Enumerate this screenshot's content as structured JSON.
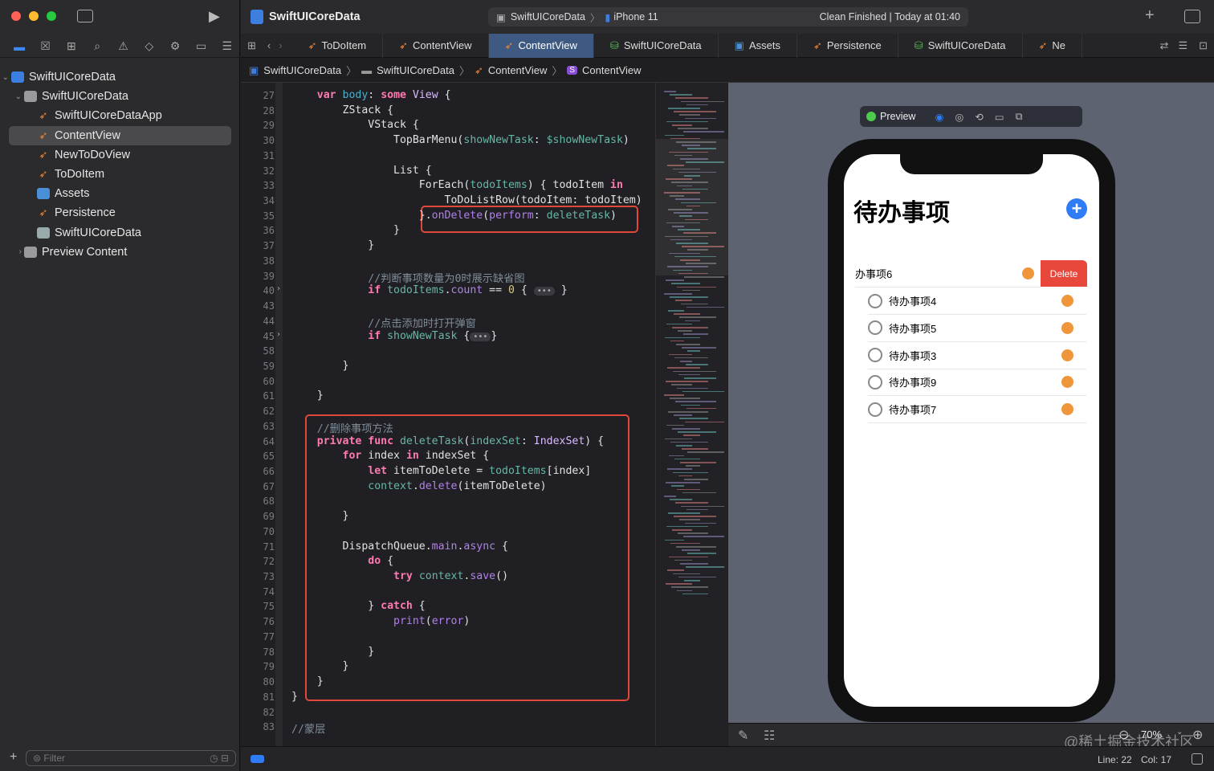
{
  "window": {
    "project": "SwiftUICoreData",
    "scheme": "SwiftUICoreData",
    "device": "iPhone 11",
    "status": "Clean Finished | Today at 01:40"
  },
  "sidebar": {
    "items": [
      {
        "label": "SwiftUICoreData",
        "icon": "project-icon",
        "level": 0,
        "expanded": true
      },
      {
        "label": "SwiftUICoreData",
        "icon": "folder-icon",
        "level": 1,
        "expanded": true
      },
      {
        "label": "SwiftUICoreDataApp",
        "icon": "swift-file-icon",
        "level": 2
      },
      {
        "label": "ContentView",
        "icon": "swift-file-icon",
        "level": 2,
        "selected": true
      },
      {
        "label": "NewToDoView",
        "icon": "swift-file-icon",
        "level": 2
      },
      {
        "label": "ToDoItem",
        "icon": "swift-file-icon",
        "level": 2
      },
      {
        "label": "Assets",
        "icon": "assets-icon",
        "level": 2
      },
      {
        "label": "Persistence",
        "icon": "swift-file-icon",
        "level": 2
      },
      {
        "label": "SwiftUICoreData",
        "icon": "coredata-icon",
        "level": 2
      },
      {
        "label": "Preview Content",
        "icon": "folder-icon",
        "level": 1,
        "expanded": false
      }
    ],
    "filter_placeholder": "Filter"
  },
  "tabs": [
    {
      "label": "ToDoItem"
    },
    {
      "label": "ContentView"
    },
    {
      "label": "ContentView",
      "active": true
    },
    {
      "label": "SwiftUICoreData"
    },
    {
      "label": "Assets"
    },
    {
      "label": "Persistence"
    },
    {
      "label": "SwiftUICoreData"
    },
    {
      "label": "Ne"
    }
  ],
  "breadcrumb": [
    "SwiftUICoreData",
    "SwiftUICoreData",
    "ContentView",
    "ContentView"
  ],
  "code": [
    {
      "n": "27",
      "t": [
        [
          "    ",
          "d"
        ],
        [
          "var",
          "k"
        ],
        [
          " body",
          "b"
        ],
        [
          ": ",
          "d"
        ],
        [
          "some",
          "k"
        ],
        [
          " View",
          "t"
        ],
        [
          " {",
          "d"
        ]
      ]
    },
    {
      "n": "28",
      "t": [
        [
          "        ZStack {",
          "d"
        ]
      ]
    },
    {
      "n": "29",
      "t": [
        [
          "            VStack {",
          "d"
        ]
      ]
    },
    {
      "n": "30",
      "t": [
        [
          "                TopBarMenu(",
          "d"
        ],
        [
          "showNewTask",
          "p"
        ],
        [
          ": ",
          "d"
        ],
        [
          "$showNewTask",
          "p"
        ],
        [
          ")",
          "d"
        ]
      ]
    },
    {
      "n": "31",
      "t": []
    },
    {
      "n": "32",
      "t": [
        [
          "                List {",
          "d"
        ]
      ]
    },
    {
      "n": "33",
      "t": [
        [
          "                    ForEach(",
          "d"
        ],
        [
          "todoItems",
          "p"
        ],
        [
          ") { todoItem ",
          "d"
        ],
        [
          "in",
          "k"
        ]
      ]
    },
    {
      "n": "34",
      "t": [
        [
          "                        ToDoListRow(todoItem: todoItem)",
          "d"
        ]
      ]
    },
    {
      "n": "35",
      "t": [
        [
          "                    }.",
          "d"
        ],
        [
          "onDelete",
          "m"
        ],
        [
          "(",
          "d"
        ],
        [
          "perform",
          "m"
        ],
        [
          ": ",
          "d"
        ],
        [
          "deleteTask",
          "p"
        ],
        [
          ")",
          "d"
        ]
      ]
    },
    {
      "n": "36",
      "t": [
        [
          "                }",
          "d"
        ]
      ]
    },
    {
      "n": "37",
      "t": [
        [
          "            }",
          "d"
        ]
      ]
    },
    {
      "n": "38",
      "t": []
    },
    {
      "n": "39",
      "t": [
        [
          "            //判断事项数量为0时展示缺省图",
          "c"
        ]
      ]
    },
    {
      "n": "40",
      "t": [
        [
          "            ",
          "d"
        ],
        [
          "if",
          "k"
        ],
        [
          " todoItems",
          "p"
        ],
        [
          ".",
          "d"
        ],
        [
          "count",
          "m"
        ],
        [
          " == ",
          "d"
        ],
        [
          "0",
          "n"
        ],
        [
          " { ",
          "d"
        ],
        [
          "•••",
          "fold"
        ],
        [
          " }",
          "d"
        ]
      ]
    },
    {
      "n": "43",
      "t": []
    },
    {
      "n": "44",
      "t": [
        [
          "            //点击添加时打开弹窗",
          "c"
        ]
      ]
    },
    {
      "n": "45",
      "t": [
        [
          "            ",
          "d"
        ],
        [
          "if",
          "k"
        ],
        [
          " showNewTask",
          "p"
        ],
        [
          " {",
          "d"
        ],
        [
          "•••",
          "fold"
        ],
        [
          "}",
          "d"
        ]
      ]
    },
    {
      "n": "58",
      "t": []
    },
    {
      "n": "59",
      "t": [
        [
          "        }",
          "d"
        ]
      ]
    },
    {
      "n": "60",
      "t": []
    },
    {
      "n": "61",
      "t": [
        [
          "    }",
          "d"
        ]
      ]
    },
    {
      "n": "62",
      "t": []
    },
    {
      "n": "63",
      "t": [
        [
          "    //删除事项方法",
          "c"
        ]
      ]
    },
    {
      "n": "64",
      "t": [
        [
          "    ",
          "d"
        ],
        [
          "private func",
          "k"
        ],
        [
          " deleteTask",
          "p"
        ],
        [
          "(",
          "d"
        ],
        [
          "indexSet",
          "p"
        ],
        [
          ": ",
          "d"
        ],
        [
          "IndexSet",
          "t"
        ],
        [
          ") {",
          "d"
        ]
      ]
    },
    {
      "n": "65",
      "t": [
        [
          "        ",
          "d"
        ],
        [
          "for",
          "k"
        ],
        [
          " index ",
          "d"
        ],
        [
          "in",
          "k"
        ],
        [
          " indexSet {",
          "d"
        ]
      ]
    },
    {
      "n": "66",
      "t": [
        [
          "            ",
          "d"
        ],
        [
          "let",
          "k"
        ],
        [
          " itemToDelete = ",
          "d"
        ],
        [
          "todoItems",
          "p"
        ],
        [
          "[index]",
          "d"
        ]
      ]
    },
    {
      "n": "67",
      "t": [
        [
          "            ",
          "d"
        ],
        [
          "context",
          "p"
        ],
        [
          ".",
          "d"
        ],
        [
          "delete",
          "m"
        ],
        [
          "(itemToDelete)",
          "d"
        ]
      ]
    },
    {
      "n": "68",
      "t": []
    },
    {
      "n": "69",
      "t": [
        [
          "        }",
          "d"
        ]
      ]
    },
    {
      "n": "70",
      "t": []
    },
    {
      "n": "71",
      "t": [
        [
          "        DispatchQueue.",
          "d"
        ],
        [
          "main",
          "m"
        ],
        [
          ".",
          "d"
        ],
        [
          "async",
          "m"
        ],
        [
          " {",
          "d"
        ]
      ]
    },
    {
      "n": "72",
      "t": [
        [
          "            ",
          "d"
        ],
        [
          "do",
          "k"
        ],
        [
          " {",
          "d"
        ]
      ]
    },
    {
      "n": "73",
      "t": [
        [
          "                ",
          "d"
        ],
        [
          "try",
          "k"
        ],
        [
          " context",
          "p"
        ],
        [
          ".",
          "d"
        ],
        [
          "save",
          "m"
        ],
        [
          "()",
          "d"
        ]
      ]
    },
    {
      "n": "74",
      "t": []
    },
    {
      "n": "75",
      "t": [
        [
          "            } ",
          "d"
        ],
        [
          "catch",
          "k"
        ],
        [
          " {",
          "d"
        ]
      ]
    },
    {
      "n": "76",
      "t": [
        [
          "                ",
          "d"
        ],
        [
          "print",
          "m"
        ],
        [
          "(",
          "d"
        ],
        [
          "error",
          "m"
        ],
        [
          ")",
          "d"
        ]
      ]
    },
    {
      "n": "77",
      "t": []
    },
    {
      "n": "78",
      "t": [
        [
          "            }",
          "d"
        ]
      ]
    },
    {
      "n": "79",
      "t": [
        [
          "        }",
          "d"
        ]
      ]
    },
    {
      "n": "80",
      "t": [
        [
          "    }",
          "d"
        ]
      ]
    },
    {
      "n": "81",
      "t": [
        [
          "}",
          "d"
        ]
      ]
    },
    {
      "n": "82",
      "t": []
    },
    {
      "n": "83",
      "t": [
        [
          "//蒙层",
          "c"
        ]
      ]
    }
  ],
  "preview": {
    "label": "Preview",
    "title": "待办事项",
    "delete_label": "Delete",
    "swiped_item": "办事项6",
    "items": [
      "待办事项4",
      "待办事项5",
      "待办事项3",
      "待办事项9",
      "待办事项7"
    ],
    "zoom": "70%",
    "accent": "#2f7cf6",
    "dot_color": "#f0963a",
    "delete_color": "#e8473b"
  },
  "status": {
    "line": "Line: 22",
    "col": "Col: 17"
  },
  "watermark": "@稀土掘金技术社区"
}
